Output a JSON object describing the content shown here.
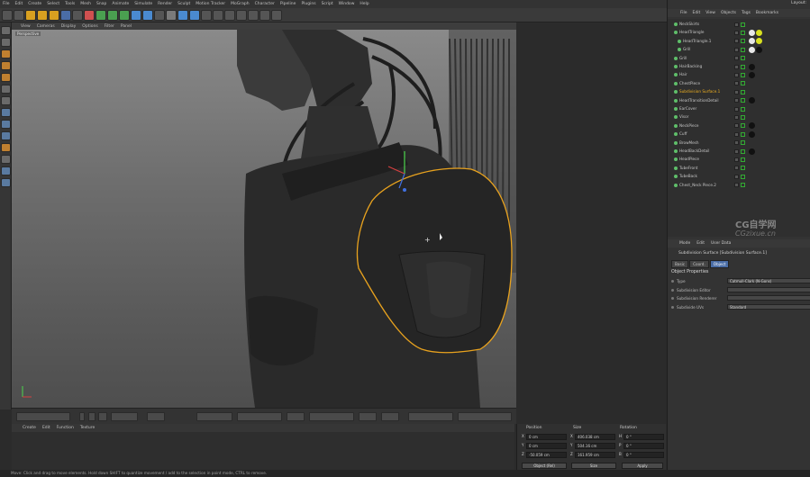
{
  "menubar": [
    "File",
    "Edit",
    "Create",
    "Select",
    "Tools",
    "Mesh",
    "Snap",
    "Animate",
    "Simulate",
    "Render",
    "Sculpt",
    "Motion Tracker",
    "MoGraph",
    "Character",
    "Pipeline",
    "Plugins",
    "Script",
    "Window",
    "Help"
  ],
  "layout_label": "Layout:",
  "viewport": {
    "menu": [
      "View",
      "Cameras",
      "Display",
      "Options",
      "Filter",
      "Panel"
    ],
    "camera_label": "Perspective"
  },
  "material_menu": [
    "Create",
    "Edit",
    "Function",
    "Texture"
  ],
  "object_manager": {
    "menu": [
      "File",
      "Edit",
      "View",
      "Objects",
      "Tags",
      "Bookmarks"
    ],
    "objects": [
      {
        "name": "NeckSkirts",
        "indent": 1,
        "tags": [],
        "highlight": false
      },
      {
        "name": "HeadTriangle",
        "indent": 1,
        "tags": [
          "#e8e8e8",
          "#d8e020"
        ],
        "highlight": false
      },
      {
        "name": "HeadTriangle.1",
        "indent": 2,
        "tags": [
          "#e8e8e8",
          "#d8e020"
        ],
        "highlight": false
      },
      {
        "name": "Grill",
        "indent": 2,
        "tags": [
          "#e8e8e8",
          "#111111"
        ],
        "highlight": false
      },
      {
        "name": "Grill",
        "indent": 1,
        "tags": [],
        "highlight": false
      },
      {
        "name": "HairBacking",
        "indent": 1,
        "tags": [
          "#111111"
        ],
        "highlight": false
      },
      {
        "name": "Hair",
        "indent": 1,
        "tags": [
          "#111111"
        ],
        "highlight": false
      },
      {
        "name": "ChestPiece",
        "indent": 1,
        "tags": [],
        "highlight": false
      },
      {
        "name": "Subdivision Surface.1",
        "indent": 1,
        "tags": [],
        "highlight": true
      },
      {
        "name": "HeadTransitionDetail",
        "indent": 1,
        "tags": [
          "#111111"
        ],
        "highlight": false
      },
      {
        "name": "EarCover",
        "indent": 1,
        "tags": [],
        "highlight": false
      },
      {
        "name": "Visor",
        "indent": 1,
        "tags": [],
        "highlight": false
      },
      {
        "name": "NeckPiece",
        "indent": 1,
        "tags": [
          "#111111"
        ],
        "highlight": false
      },
      {
        "name": "Cuff",
        "indent": 1,
        "tags": [
          "#111111"
        ],
        "highlight": false
      },
      {
        "name": "BrowMesh",
        "indent": 1,
        "tags": [],
        "highlight": false
      },
      {
        "name": "HeadBackDetail",
        "indent": 1,
        "tags": [
          "#111111"
        ],
        "highlight": false
      },
      {
        "name": "HeadPiece",
        "indent": 1,
        "tags": [],
        "highlight": false
      },
      {
        "name": "TubeFront",
        "indent": 1,
        "tags": [],
        "highlight": false
      },
      {
        "name": "TubeBack",
        "indent": 1,
        "tags": [],
        "highlight": false
      },
      {
        "name": "Chest_Neck Piece.2",
        "indent": 1,
        "tags": [],
        "highlight": false
      }
    ]
  },
  "watermark": {
    "line1": "CG自学网",
    "line2": "CGzixue.cn"
  },
  "attribute_manager": {
    "menu": [
      "Mode",
      "Edit",
      "User Data"
    ],
    "title": "Subdivision Surface [Subdivision Surface.1]",
    "tabs": [
      "Basic",
      "Coord.",
      "Object"
    ],
    "active_tab": "Object",
    "section": "Object Properties",
    "properties": [
      {
        "label": "Type",
        "value": "Catmull-Clark (N-Gons)"
      },
      {
        "label": "Subdivision Editor",
        "value": ""
      },
      {
        "label": "Subdivision Renderer",
        "value": ""
      },
      {
        "label": "Subdivide UVs",
        "value": "Standard"
      }
    ]
  },
  "coordinates": {
    "headers": [
      "Position",
      "Size",
      "Rotation"
    ],
    "rows": [
      {
        "axis": "X",
        "pos": "0 cm",
        "size_axis": "X",
        "size": "406.038 cm",
        "rot_axis": "H",
        "rot": "0 °"
      },
      {
        "axis": "Y",
        "pos": "0 cm",
        "size_axis": "Y",
        "size": "504.16 cm",
        "rot_axis": "P",
        "rot": "0 °"
      },
      {
        "axis": "Z",
        "pos": "-50.059 cm",
        "size_axis": "Z",
        "size": "161.959 cm",
        "rot_axis": "B",
        "rot": "0 °"
      }
    ],
    "mode_select": "Object (Rel)",
    "size_select": "Size",
    "apply_label": "Apply"
  },
  "status": "Move: Click and drag to move elements. Hold down SHIFT to quantize movement / add to the selection in point mode, CTRL to remove.",
  "colors": {
    "selection_outline": "#e8a21e",
    "accent_tab": "#4a6da6"
  }
}
